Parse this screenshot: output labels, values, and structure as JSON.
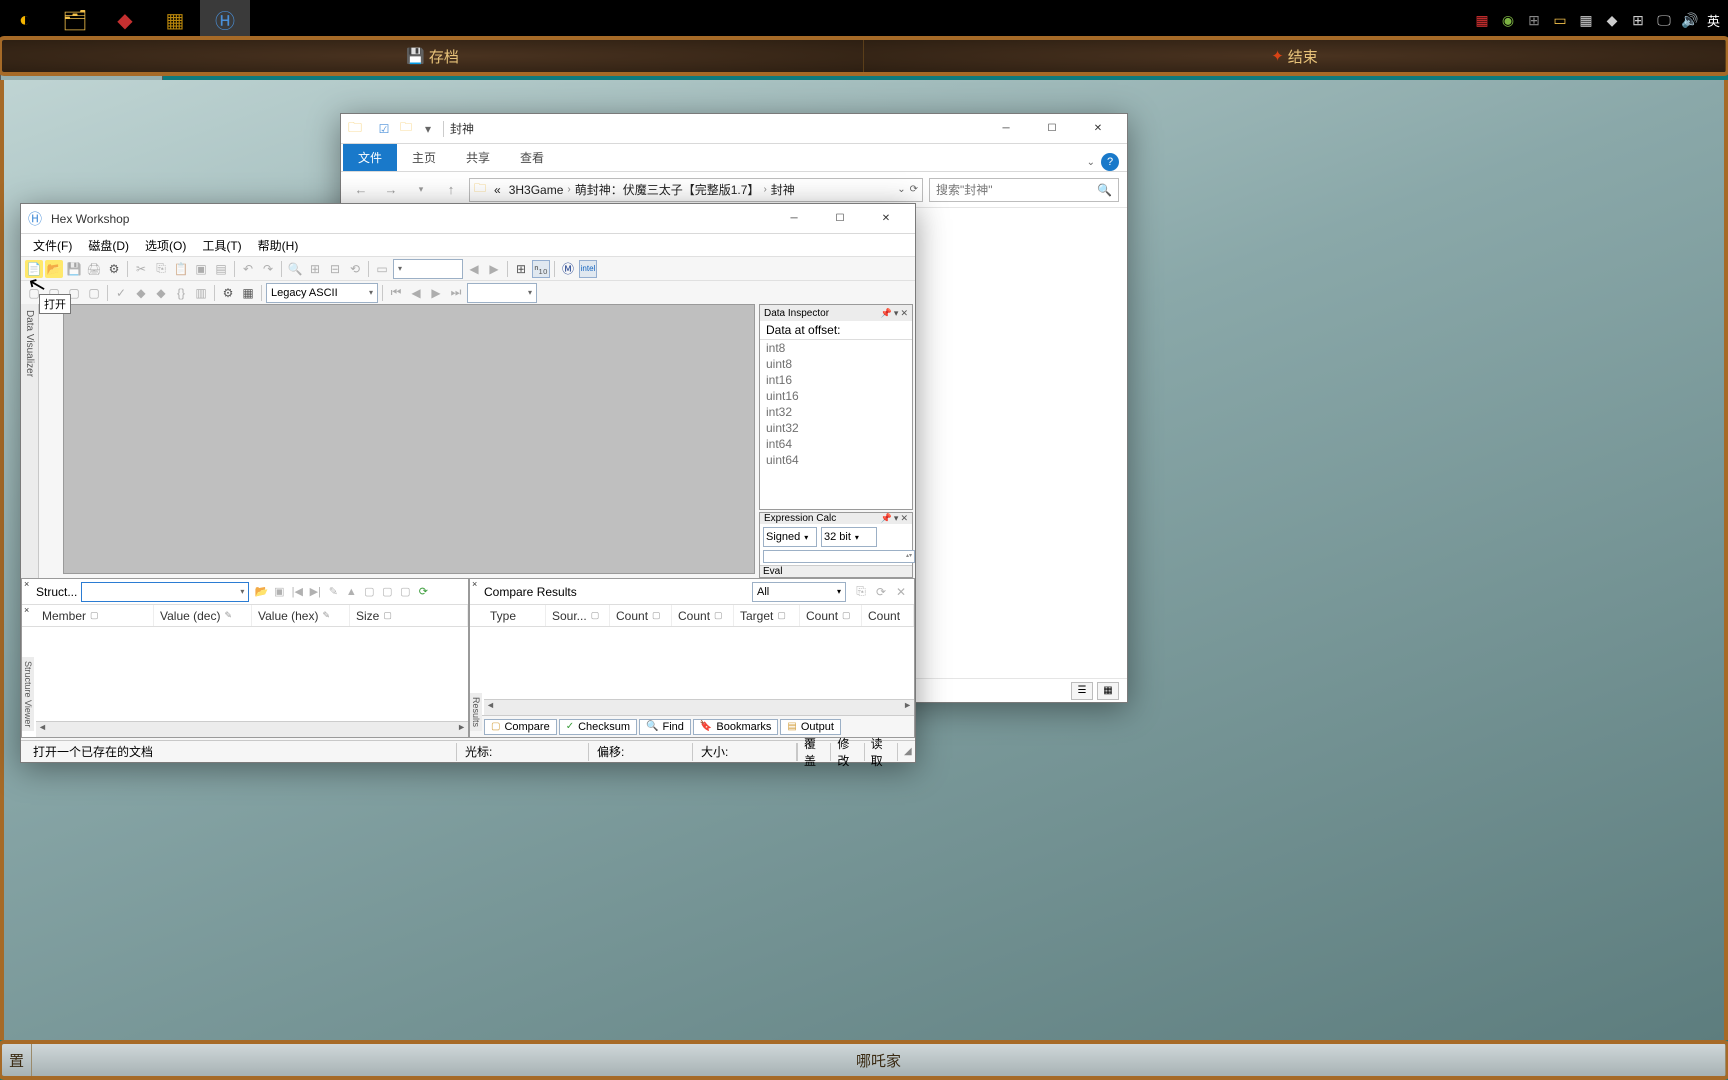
{
  "taskbar": {
    "tray_lang": "英"
  },
  "explorer": {
    "title": "封神",
    "tabs": [
      "文件",
      "主页",
      "共享",
      "查看"
    ],
    "active_tab": 0,
    "breadcrumb": [
      "3H3Game",
      "萌封神：伏魔三太子【完整版1.7】",
      "封神"
    ],
    "search_placeholder": "搜索\"封神\""
  },
  "game": {
    "top_buttons": [
      {
        "icon": "💾",
        "label": "存档"
      },
      {
        "icon": "✖",
        "label": "结束"
      }
    ],
    "bottom_buttons": [
      "置",
      "哪吒家"
    ]
  },
  "hexw": {
    "title": "Hex Workshop",
    "menus": [
      "文件(F)",
      "磁盘(D)",
      "选项(O)",
      "工具(T)",
      "帮助(H)"
    ],
    "encoding": "Legacy ASCII",
    "dv_tab": "Data Visualizer",
    "data_inspector": {
      "title": "Data Inspector",
      "subtitle": "Data at offset:",
      "types": [
        "int8",
        "uint8",
        "int16",
        "uint16",
        "int32",
        "uint32",
        "int64",
        "uint64"
      ]
    },
    "calc": {
      "title": "Expression Calc",
      "sign": "Signed",
      "bits": "32 bit",
      "eval": "Eval"
    },
    "tooltip": "打开",
    "struct": {
      "label": "Struct...",
      "columns": [
        "Member",
        "Value (dec)",
        "Value (hex)",
        "Size"
      ],
      "vtab": "Structure Viewer"
    },
    "compare": {
      "title": "Compare Results",
      "filter": "All",
      "columns": [
        "Type",
        "Sour...",
        "Count",
        "Count",
        "Target",
        "Count",
        "Count"
      ],
      "vtab": "Results",
      "tabs": [
        "Compare",
        "Checksum",
        "Find",
        "Bookmarks",
        "Output"
      ]
    },
    "status": {
      "hint": "打开一个已存在的文档",
      "cursor": "光标:",
      "offset": "偏移:",
      "size": "大小:",
      "mode": [
        "覆盖",
        "修改",
        "读取"
      ]
    }
  }
}
